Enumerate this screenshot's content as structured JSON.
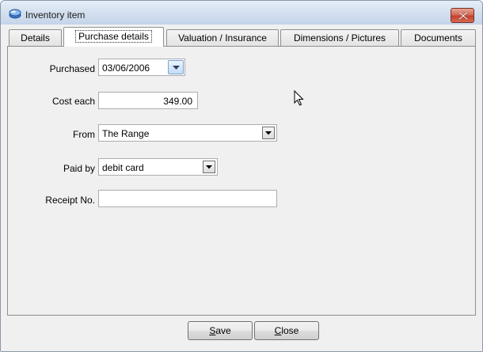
{
  "window": {
    "title": "Inventory item"
  },
  "tabs": [
    {
      "label": "Details"
    },
    {
      "label": "Purchase details",
      "active": true
    },
    {
      "label": "Valuation / Insurance"
    },
    {
      "label": "Dimensions / Pictures"
    },
    {
      "label": "Documents"
    }
  ],
  "form": {
    "purchased_label": "Purchased",
    "purchased_value": "03/06/2006",
    "cost_label": "Cost each",
    "cost_value": "349.00",
    "from_label": "From",
    "from_value": "The Range",
    "paidby_label": "Paid by",
    "paidby_value": "debit card",
    "receipt_label": "Receipt No.",
    "receipt_value": ""
  },
  "footer": {
    "save_mnemonic": "S",
    "save_rest": "ave",
    "close_mnemonic": "C",
    "close_rest": "lose"
  },
  "icons": {
    "app": "inventory-app-icon",
    "close": "close-icon",
    "dropdown": "chevron-down-icon",
    "cursor": "mouse-pointer-icon"
  },
  "colors": {
    "titlebar": "#d5e1f0",
    "close_button": "#c4412c",
    "panel_bg": "#f0f0f0",
    "tab_active_bg": "#ffffff"
  }
}
